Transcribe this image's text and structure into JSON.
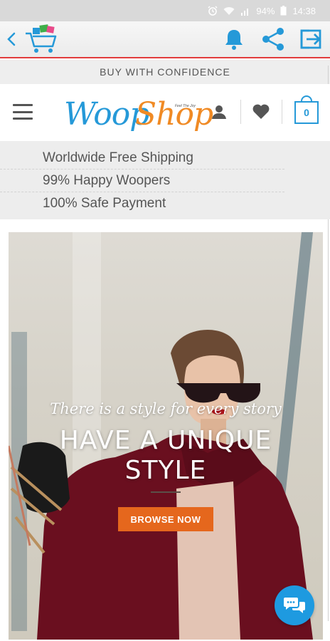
{
  "status_bar": {
    "battery": "94%",
    "time": "14:38",
    "icons": [
      "alarm-icon",
      "wifi-icon",
      "signal-icon",
      "battery-icon"
    ]
  },
  "app_bar": {
    "icons": [
      "back-arrow-icon",
      "shopping-cart-logo-icon",
      "bell-icon",
      "share-icon",
      "exit-icon"
    ],
    "accent_color": "#2599d8",
    "border_color": "#e23b3b"
  },
  "confidence_banner": "BUY WITH CONFIDENCE",
  "site_header": {
    "brand_part1": "Woop",
    "brand_part2": "Shop",
    "brand_tagline": "Feel The Joy",
    "brand_colors": [
      "#2599d8",
      "#f08a24"
    ],
    "cart_count": "0",
    "icons": [
      "menu-icon",
      "user-icon",
      "heart-icon",
      "cart-bag-icon"
    ]
  },
  "benefits": [
    "Worldwide Free Shipping",
    "99% Happy Woopers",
    "100% Safe Payment"
  ],
  "hero": {
    "script_line": "There is a style for every story",
    "title_line1": "HAVE A UNIQUE",
    "title_line2": "STYLE",
    "button_label": "BROWSE NOW",
    "button_color": "#e5671d"
  },
  "chat": {
    "icon": "chat-bubbles-icon",
    "color": "#1e9ae0"
  }
}
